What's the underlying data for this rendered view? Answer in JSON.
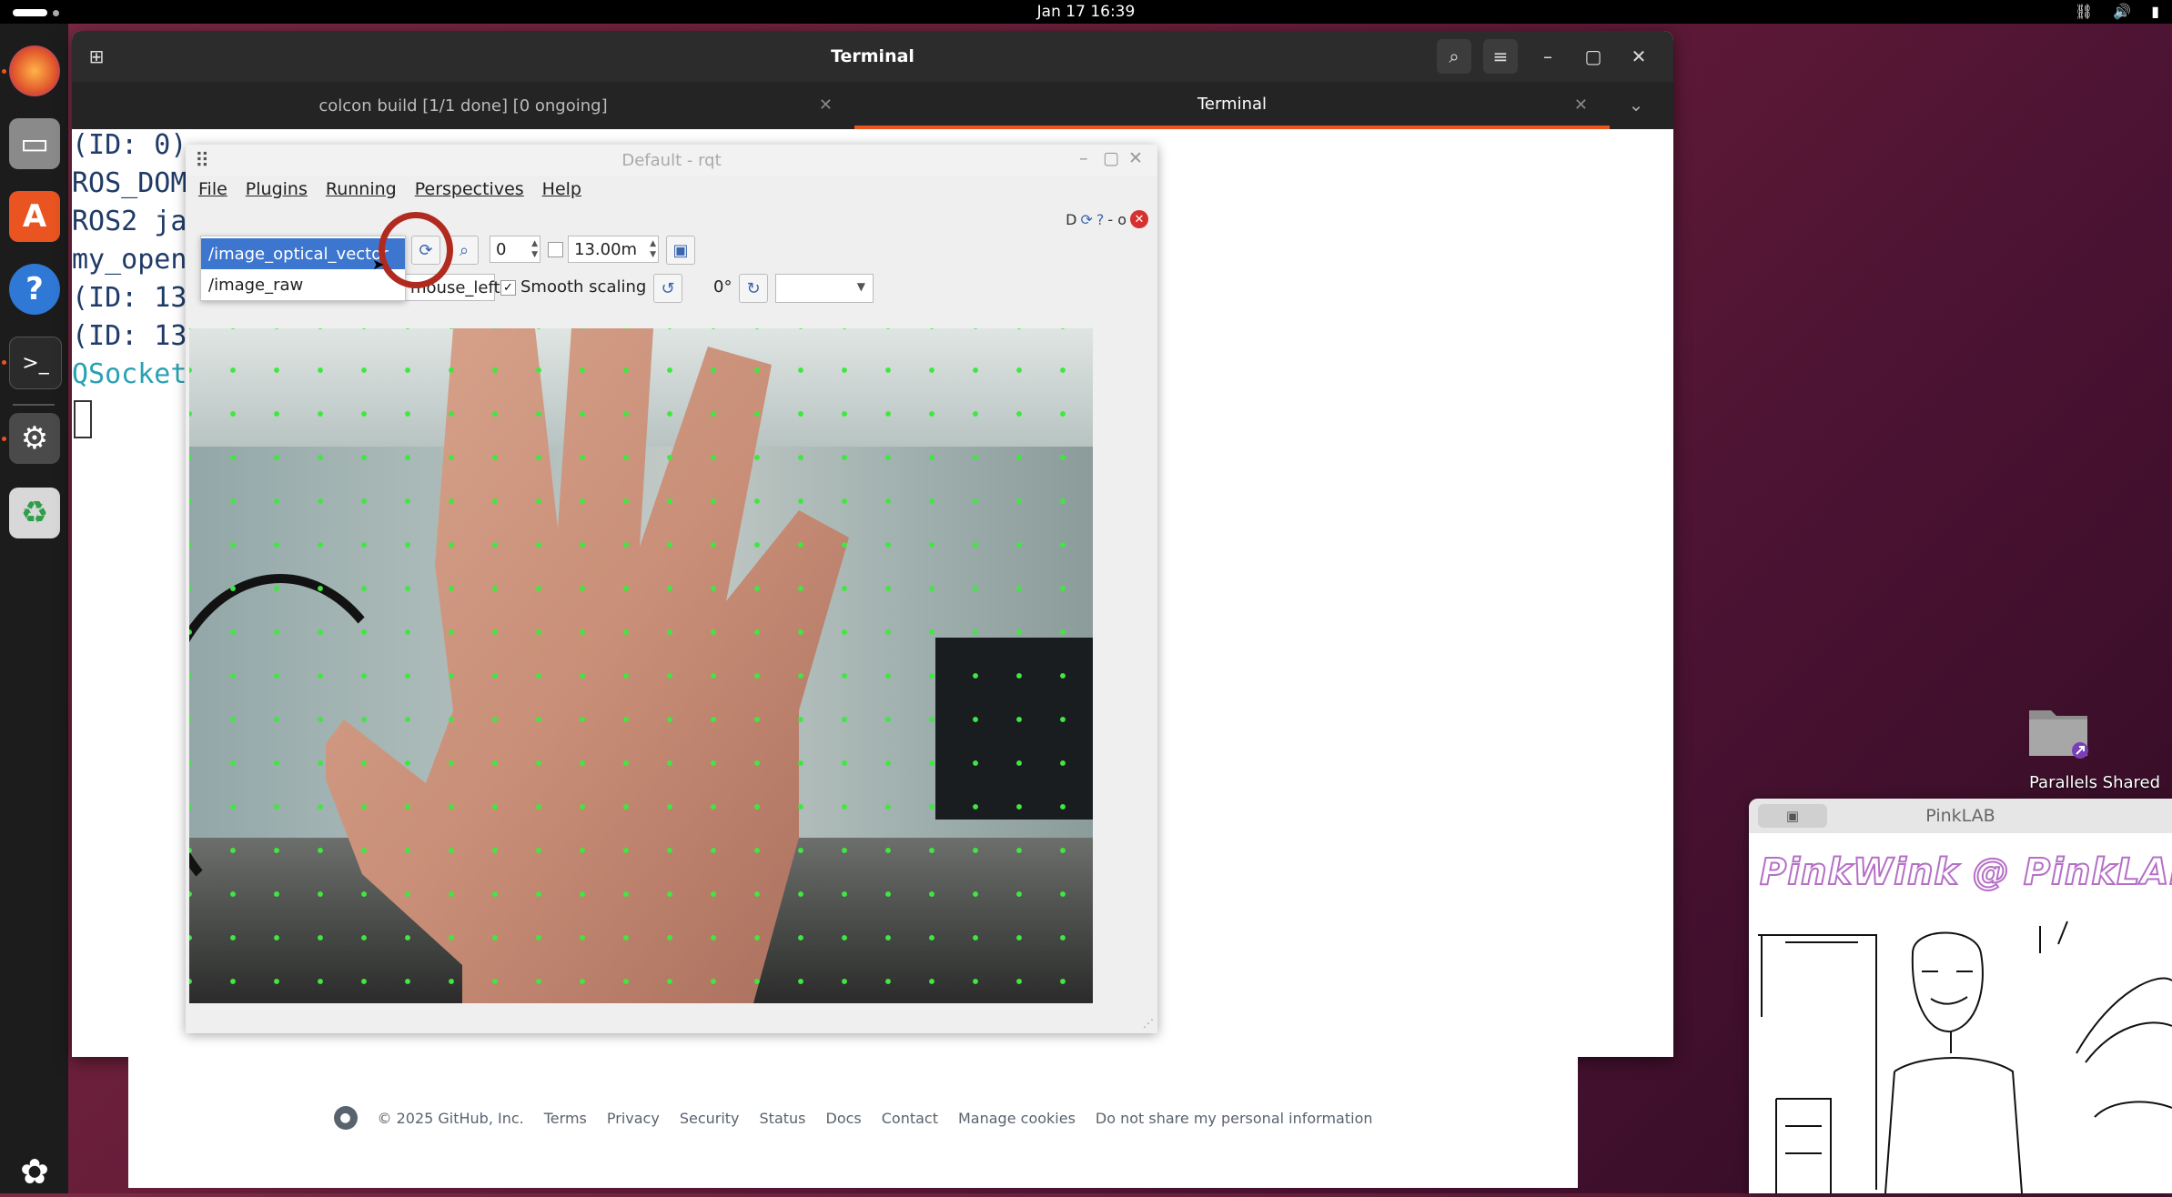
{
  "topbar": {
    "clock": "Jan 17  16:39"
  },
  "terminal": {
    "title": "Terminal",
    "tabs": [
      {
        "label": "colcon build [1/1 done] [0 ongoing]"
      },
      {
        "label": "Terminal"
      }
    ],
    "lines": [
      "(ID: 0)",
      "ROS_DOM",
      "ROS2 ja",
      "my_open",
      "(ID: 13",
      "(ID: 13",
      "QSocket"
    ]
  },
  "rqt": {
    "title": "Default - rqt",
    "menu": [
      "File",
      "Plugins",
      "Running",
      "Perspectives",
      "Help"
    ],
    "plugin_controls": "D",
    "topics": [
      "/image_optical_vector",
      "/image_raw"
    ],
    "spin_value": "0",
    "timeout_value": "13.00m",
    "mouse_topic": "mouse_left",
    "smooth_scaling_label": "Smooth scaling",
    "rotation_label": "0°"
  },
  "github": {
    "copyright": "© 2025 GitHub, Inc.",
    "links": [
      "Terms",
      "Privacy",
      "Security",
      "Status",
      "Docs",
      "Contact",
      "Manage cookies",
      "Do not share my personal information"
    ]
  },
  "desktop": {
    "folder_label": "Parallels Shared"
  },
  "pinklab": {
    "title": "PinkLAB",
    "banner": "PinkWink @  PinkLAB"
  },
  "colors": {
    "accent": "#e95420",
    "selection": "#3d76cf",
    "annotation": "#b02a20",
    "flow_dots": "#3fe83f"
  }
}
